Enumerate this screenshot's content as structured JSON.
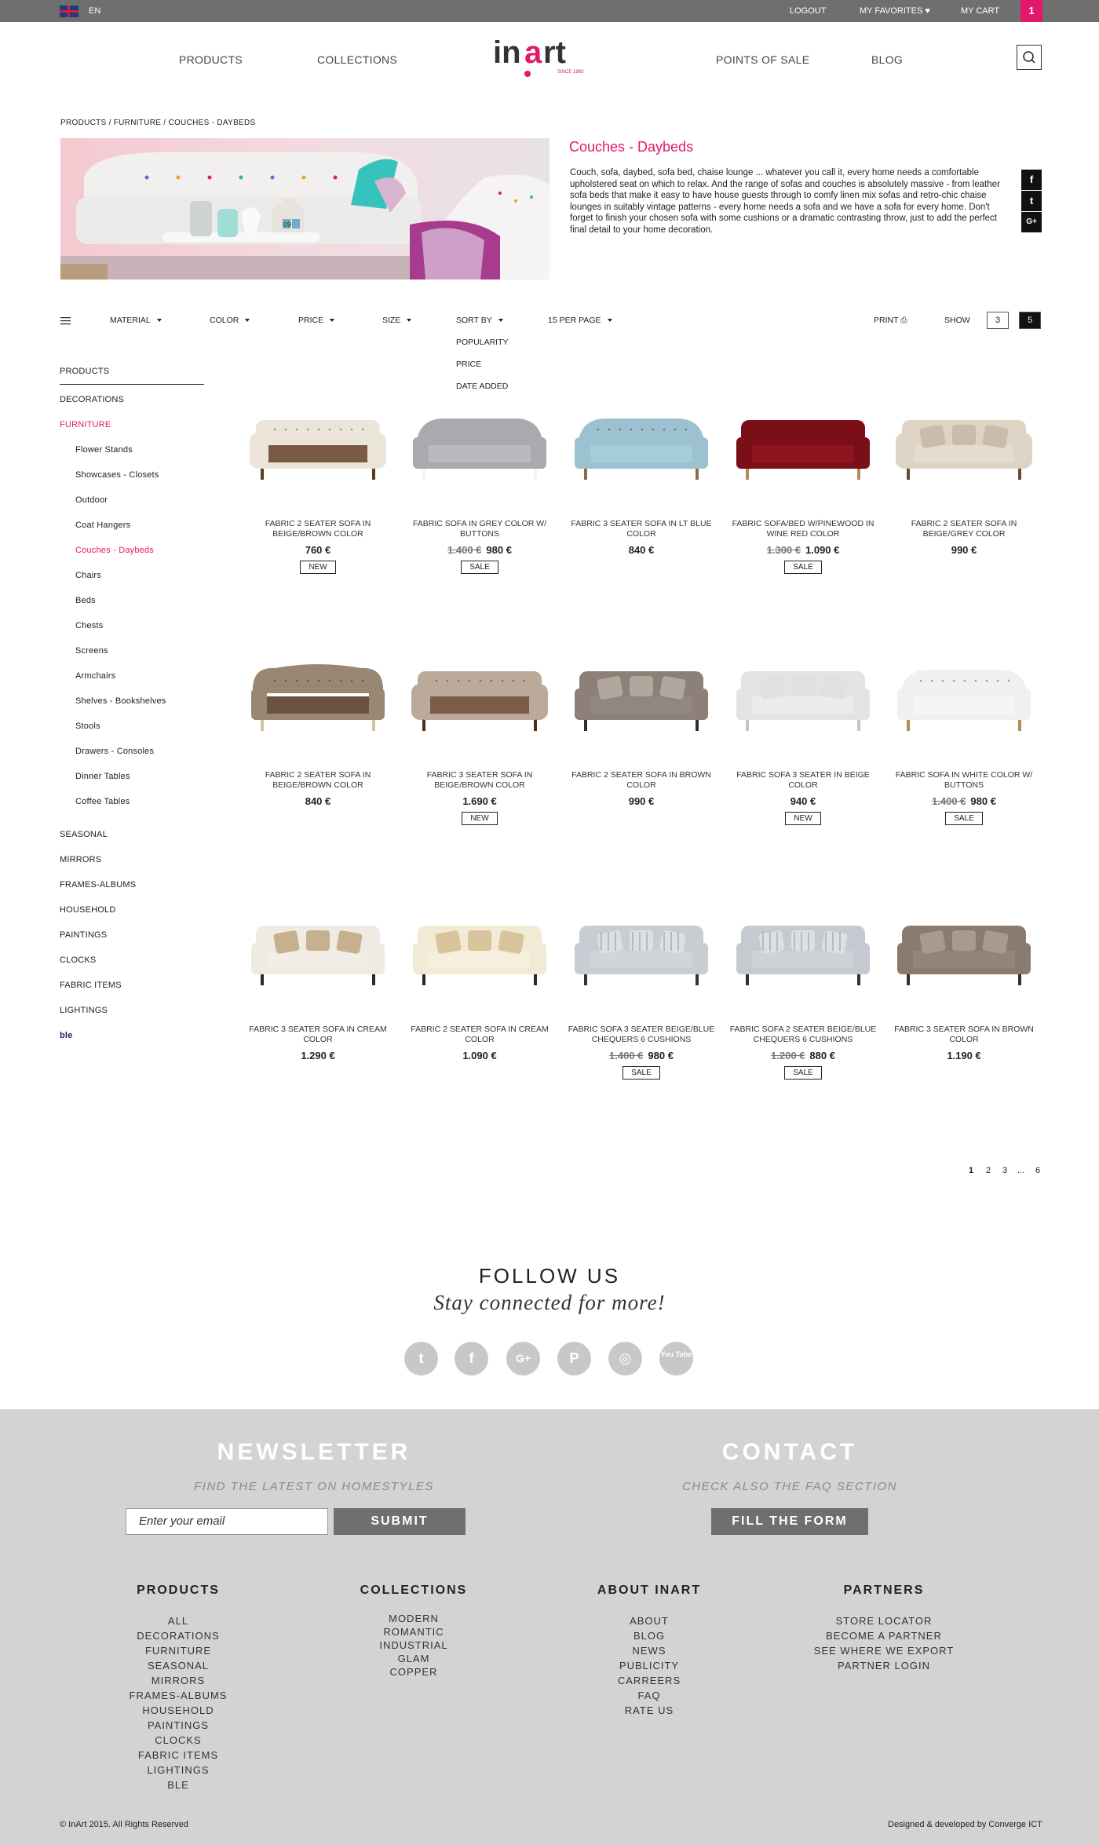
{
  "topbar": {
    "lang": "EN",
    "logout": "LOGOUT",
    "favorites": "MY FAVORITES",
    "cart": "MY CART",
    "cart_count": "1"
  },
  "header": {
    "nav_left": [
      "PRODUCTS",
      "COLLECTIONS"
    ],
    "nav_right": [
      "POINTS OF SALE",
      "BLOG"
    ],
    "logo_text": "inart",
    "logo_since": "SINCE 1983"
  },
  "breadcrumb": "PRODUCTS / FURNITURE / COUCHES - DAYBEDS",
  "category": {
    "title": "Couches - Daybeds",
    "description": "Couch, sofa, daybed, sofa bed, chaise lounge ... whatever you call it, every home needs a comfortable upholstered seat on which to relax. And the range of sofas and couches is absolutely massive - from leather sofa beds that make it easy to have house guests through to comfy linen mix sofas and retro-chic chaise lounges in suitably vintage patterns - every home needs a sofa and we have a sofa for every home. Don't forget to finish your chosen sofa with some cushions or a dramatic contrasting throw, just to add the perfect final detail to your home decoration.",
    "hero_calendar": "09"
  },
  "share": [
    "f",
    "t",
    "G+"
  ],
  "filters": {
    "material": "MATERIAL",
    "color": "COLOR",
    "price": "PRICE",
    "size": "SIZE",
    "sort": "SORT BY",
    "per_page": "15 PER PAGE",
    "sort_options": [
      "POPULARITY",
      "PRICE",
      "DATE ADDED"
    ],
    "print": "PRINT",
    "show": "SHOW",
    "show_options": [
      "3",
      "5"
    ]
  },
  "sidebar": {
    "top": [
      "PRODUCTS",
      "DECORATIONS",
      "FURNITURE"
    ],
    "sub": [
      "Flower Stands",
      "Showcases - Closets",
      "Outdoor",
      "Coat Hangers",
      "Couches - Daybeds",
      "Chairs",
      "Beds",
      "Chests",
      "Screens",
      "Armchairs",
      "Shelves - Bookshelves",
      "Stools",
      "Drawers - Consoles",
      "Dinner Tables",
      "Coffee Tables"
    ],
    "bottom": [
      "SEASONAL",
      "MIRRORS",
      "FRAMES-ALBUMS",
      "HOUSEHOLD",
      "PAINTINGS",
      "CLOCKS",
      "FABRIC ITEMS",
      "LIGHTINGS",
      "ble"
    ]
  },
  "products": [
    {
      "name": "FABRIC 2 SEATER SOFA IN BEIGE/BROWN COLOR",
      "old_price": "",
      "price": "760 €",
      "badge": "NEW"
    },
    {
      "name": "FABRIC SOFA IN GREY COLOR W/ BUTTONS",
      "old_price": "1.400 €",
      "price": "980 €",
      "badge": "SALE"
    },
    {
      "name": "FABRIC 3 SEATER SOFA IN LT BLUE COLOR",
      "old_price": "",
      "price": "840 €",
      "badge": ""
    },
    {
      "name": "FABRIC SOFA/BED W/PINEWOOD IN WINE RED COLOR",
      "old_price": "1.300 €",
      "price": "1.090 €",
      "badge": "SALE"
    },
    {
      "name": "FABRIC 2 SEATER SOFA IN BEIGE/GREY COLOR",
      "old_price": "",
      "price": "990 €",
      "badge": ""
    },
    {
      "name": "FABRIC 2 SEATER SOFA IN BEIGE/BROWN COLOR",
      "old_price": "",
      "price": "840 €",
      "badge": ""
    },
    {
      "name": "FABRIC 3 SEATER SOFA IN BEIGE/BROWN COLOR",
      "old_price": "",
      "price": "1.690 €",
      "badge": "NEW"
    },
    {
      "name": "FABRIC 2 SEATER SOFA IN BROWN COLOR",
      "old_price": "",
      "price": "990 €",
      "badge": ""
    },
    {
      "name": "FABRIC SOFA 3 SEATER IN BEIGE COLOR",
      "old_price": "",
      "price": "940 €",
      "badge": "NEW"
    },
    {
      "name": "FABRIC SOFA IN WHITE COLOR W/ BUTTONS",
      "old_price": "1.400 €",
      "price": "980 €",
      "badge": "SALE"
    },
    {
      "name": "FABRIC 3 SEATER SOFA IN CREAM COLOR",
      "old_price": "",
      "price": "1.290 €",
      "badge": ""
    },
    {
      "name": "FABRIC 2 SEATER SOFA IN CREAM COLOR",
      "old_price": "",
      "price": "1.090 €",
      "badge": ""
    },
    {
      "name": "FABRIC SOFA 3 SEATER BEIGE/BLUE CHEQUERS 6 CUSHIONS",
      "old_price": "1.400 €",
      "price": "980 €",
      "badge": "SALE"
    },
    {
      "name": "FABRIC SOFA 2 SEATER BEIGE/BLUE CHEQUERS 6 CUSHIONS",
      "old_price": "1.200 €",
      "price": "880 €",
      "badge": "SALE"
    },
    {
      "name": "FABRIC 3 SEATER SOFA IN BROWN COLOR",
      "old_price": "",
      "price": "1.190 €",
      "badge": ""
    }
  ],
  "pagination": [
    "1",
    "2",
    "3",
    "...",
    "6"
  ],
  "follow": {
    "title": "FOLLOW US",
    "subtitle": "Stay connected for more!",
    "icons": [
      "t",
      "f",
      "G+",
      "P",
      "◎",
      "You Tube"
    ]
  },
  "newsletter": {
    "title": "NEWSLETTER",
    "subtitle": "FIND THE LATEST ON HOMESTYLES",
    "placeholder": "Enter your email",
    "submit": "SUBMIT"
  },
  "contact": {
    "title": "CONTACT",
    "subtitle": "CHECK  ALSO THE FAQ SECTION",
    "button": "FILL  THE FORM"
  },
  "footer_cols": [
    {
      "title": "PRODUCTS",
      "items": [
        "ALL",
        "DECORATIONS",
        "FURNITURE",
        "SEASONAL",
        "MIRRORS",
        "FRAMES-ALBUMS",
        "HOUSEHOLD",
        "PAINTINGS",
        "CLOCKS",
        "FABRIC ITEMS",
        "LIGHTINGS",
        "BLE"
      ]
    },
    {
      "title": "COLLECTIONS",
      "items": [
        "MODERN",
        "ROMANTIC",
        "INDUSTRIAL",
        "GLAM",
        "COPPER"
      ]
    },
    {
      "title": "ABOUT INART",
      "items": [
        "ABOUT",
        "BLOG",
        "NEWS",
        "PUBLICITY",
        "CARREERS",
        "FAQ",
        "RATE US"
      ]
    },
    {
      "title": "PARTNERS",
      "items": [
        "STORE LOCATOR",
        "BECOME A PARTNER",
        "SEE WHERE WE EXPORT",
        "PARTNER LOGIN"
      ]
    }
  ],
  "copyright": "© InArt 2015. All Rights Reserved",
  "credits": "Designed & developed by Converge ICT",
  "colors": {
    "accent": "#e1186b",
    "topbar": "#6f6f6f",
    "footer": "#d3d3d3"
  }
}
